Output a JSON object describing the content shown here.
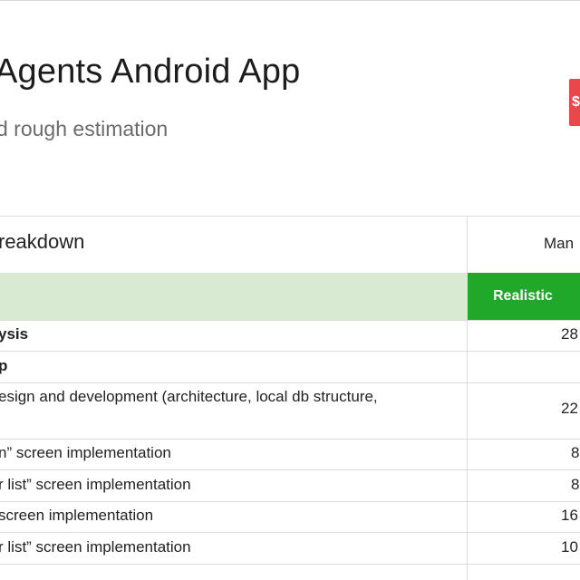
{
  "header": {
    "title": "Agents Android App",
    "subtitle": "d rough estimation",
    "badge_text": "$"
  },
  "table": {
    "section_title": "reakdown",
    "column_header": "Man",
    "estimate_label": "Realistic",
    "rows": [
      {
        "label": "ysis",
        "value": "28",
        "bold": true
      },
      {
        "label": "p",
        "value": "",
        "bold": true
      },
      {
        "label": "esign and development (architecture, local db structure,",
        "value": "22",
        "bold": false
      },
      {
        "label": "n” screen implementation",
        "value": "8",
        "bold": false
      },
      {
        "label": "r list” screen implementation",
        "value": "8",
        "bold": false
      },
      {
        "label": "screen implementation",
        "value": "16",
        "bold": false
      },
      {
        "label": "r list” screen implementation",
        "value": "10",
        "bold": false
      }
    ]
  },
  "colors": {
    "accent_green": "#1fa82a",
    "light_green": "#d9ead3",
    "badge_red": "#e8474c"
  }
}
